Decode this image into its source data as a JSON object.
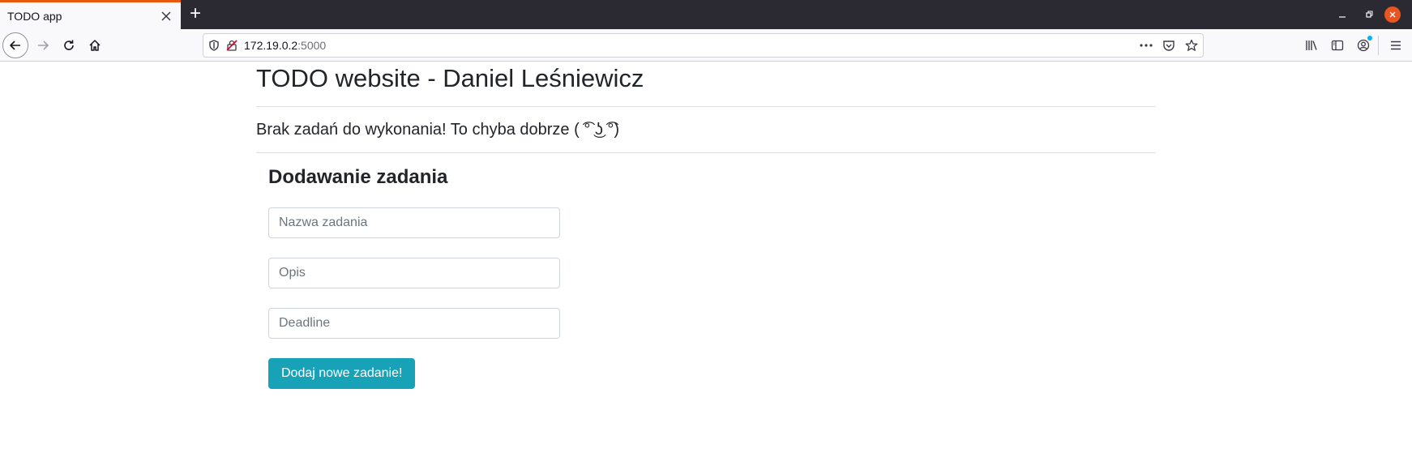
{
  "browser": {
    "tab_title": "TODO app",
    "new_tab_label": "+",
    "url_host": "172.19.0.2",
    "url_port": ":5000",
    "icons": [
      "close-icon",
      "minimize-icon",
      "restore-icon",
      "back-icon",
      "forward-icon",
      "reload-icon",
      "home-icon",
      "shield-icon",
      "insecure-lock-icon",
      "more-icon",
      "pocket-icon",
      "star-icon",
      "library-icon",
      "sidebar-icon",
      "account-icon",
      "menu-icon"
    ],
    "accent_color": "#e8590c"
  },
  "page": {
    "title": "TODO website - Daniel Leśniewicz",
    "empty_message": "Brak zadań do wykonania! To chyba dobrze ( ͡° ͜ʖ ͡°)"
  },
  "form": {
    "title": "Dodawanie zadania",
    "name_placeholder": "Nazwa zadania",
    "description_placeholder": "Opis",
    "deadline_placeholder": "Deadline",
    "submit_label": "Dodaj nowe zadanie!",
    "submit_color": "#17a2b8"
  }
}
